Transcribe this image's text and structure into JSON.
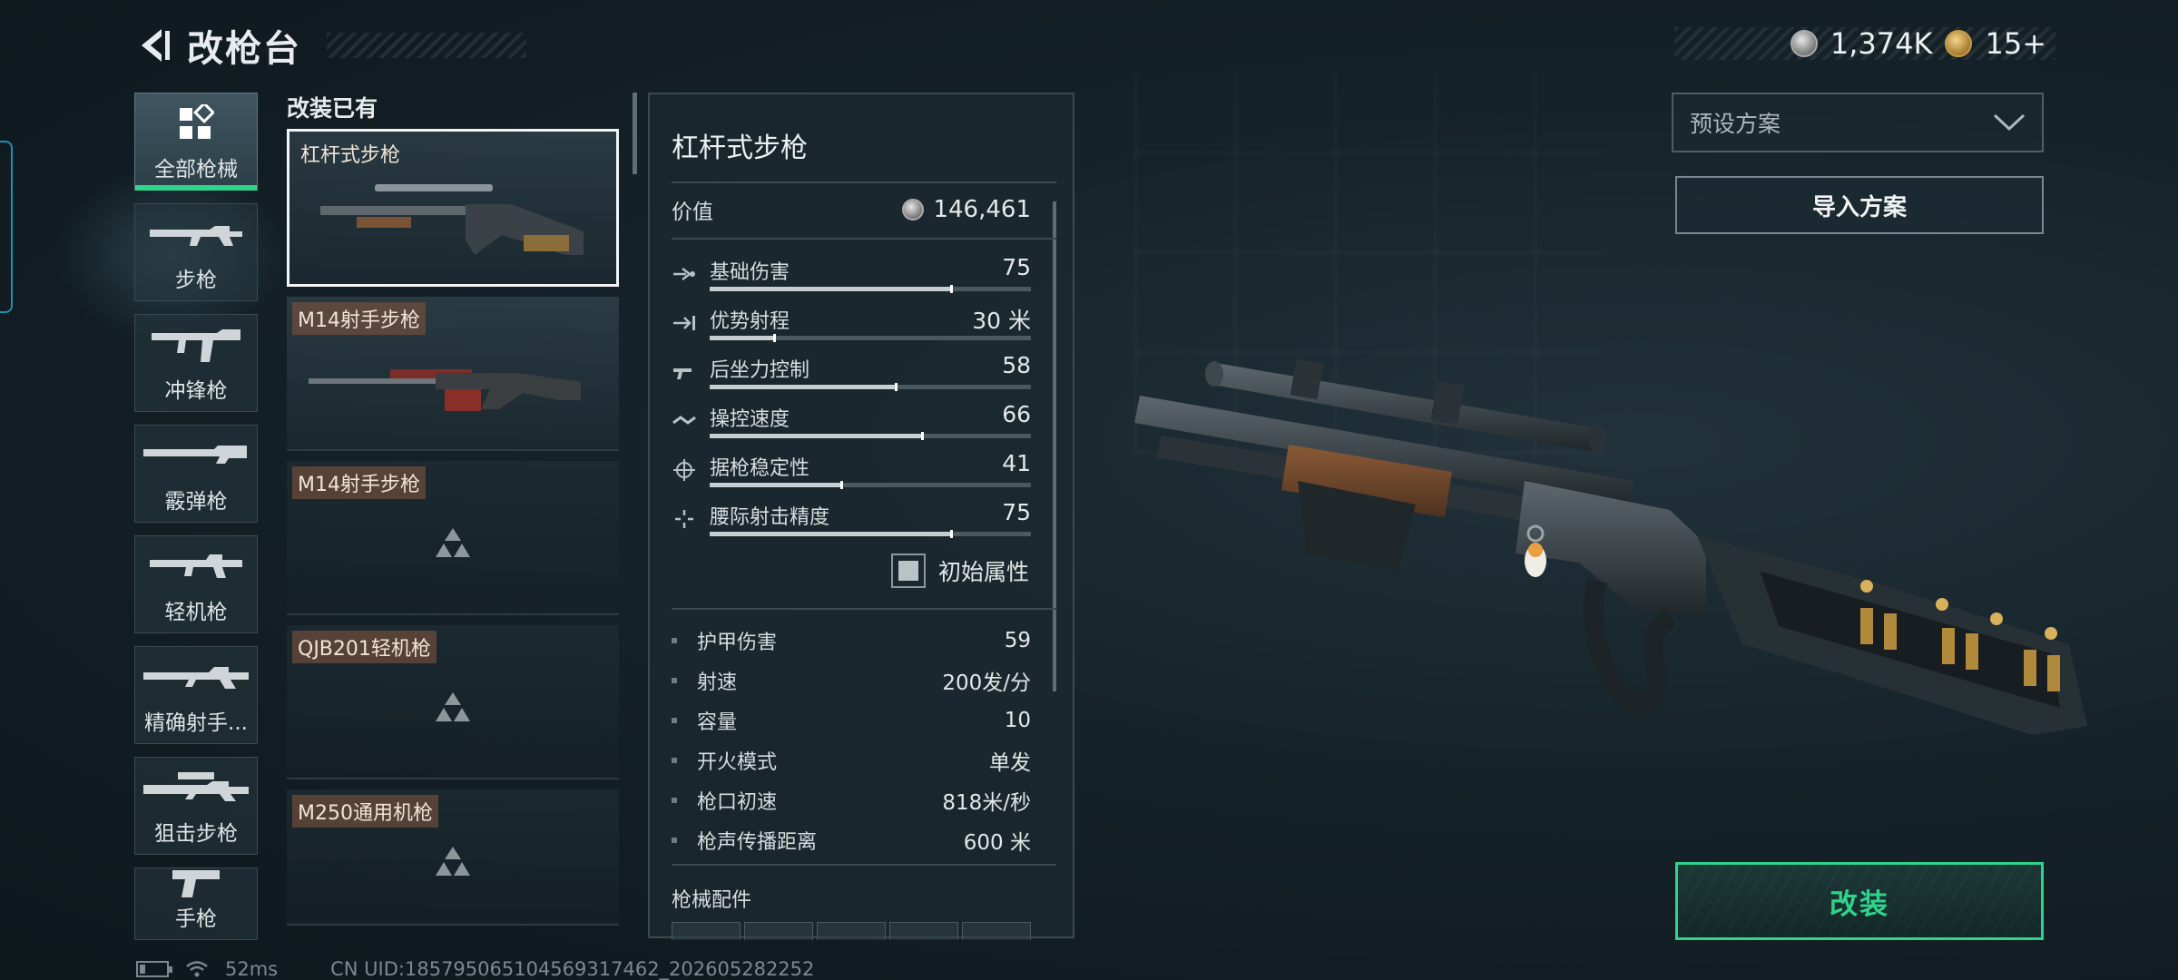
{
  "header": {
    "title": "改枪台",
    "back_icon": "back-arrow-icon"
  },
  "currency": {
    "silver_amount": "1,374K",
    "gold_amount": "15+"
  },
  "categories": [
    {
      "label": "全部枪械",
      "icon": "all-weapons-icon",
      "active": true
    },
    {
      "label": "步枪",
      "icon": "rifle-icon"
    },
    {
      "label": "冲锋枪",
      "icon": "smg-icon"
    },
    {
      "label": "霰弹枪",
      "icon": "shotgun-icon"
    },
    {
      "label": "轻机枪",
      "icon": "lmg-icon"
    },
    {
      "label": "精确射手...",
      "icon": "dmr-icon"
    },
    {
      "label": "狙击步枪",
      "icon": "sniper-icon"
    },
    {
      "label": "手枪",
      "icon": "pistol-icon"
    }
  ],
  "list": {
    "title": "改装已有",
    "items": [
      {
        "name": "杠杆式步枪",
        "selected": true,
        "has_image": true
      },
      {
        "name": "M14射手步枪",
        "has_image": true
      },
      {
        "name": "M14射手步枪",
        "has_image": false
      },
      {
        "name": "QJB201轻机枪",
        "has_image": false
      },
      {
        "name": "M250通用机枪",
        "has_image": false
      }
    ]
  },
  "stats": {
    "weapon_name": "杠杆式步枪",
    "value_label": "价值",
    "value_amount": "146,461",
    "bars": [
      {
        "name": "基础伤害",
        "value": "75",
        "level": 0.75,
        "icon": "damage-icon"
      },
      {
        "name": "优势射程",
        "value": "30 米",
        "level": 0.2,
        "icon": "range-icon"
      },
      {
        "name": "后坐力控制",
        "value": "58",
        "level": 0.58,
        "icon": "recoil-icon"
      },
      {
        "name": "操控速度",
        "value": "66",
        "level": 0.66,
        "icon": "handling-icon"
      },
      {
        "name": "据枪稳定性",
        "value": "41",
        "level": 0.41,
        "icon": "stability-icon"
      },
      {
        "name": "腰际射击精度",
        "value": "75",
        "level": 0.75,
        "icon": "hipfire-icon"
      }
    ],
    "checkbox_label": "初始属性",
    "attributes": [
      {
        "name": "护甲伤害",
        "value": "59"
      },
      {
        "name": "射速",
        "value": "200发/分"
      },
      {
        "name": "容量",
        "value": "10"
      },
      {
        "name": "开火模式",
        "value": "单发"
      },
      {
        "name": "枪口初速",
        "value": "818米/秒"
      },
      {
        "name": "枪声传播距离",
        "value": "600 米"
      }
    ],
    "parts_title": "枪械配件"
  },
  "actions": {
    "preset_label": "预设方案",
    "import_label": "导入方案",
    "modify_label": "改装"
  },
  "footer": {
    "ping": "52ms",
    "uid": "CN UID:1857950651045693174​62_202605282252"
  }
}
